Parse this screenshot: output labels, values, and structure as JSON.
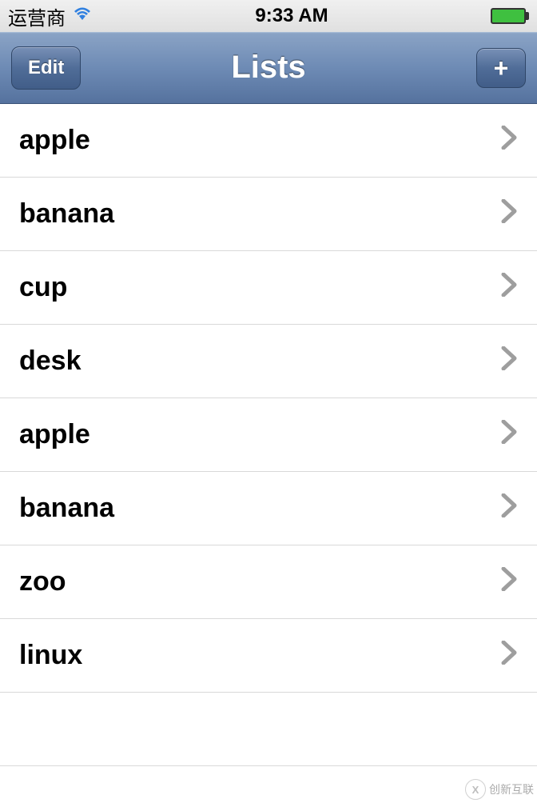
{
  "status_bar": {
    "carrier": "运营商",
    "time": "9:33 AM"
  },
  "nav": {
    "edit_label": "Edit",
    "title": "Lists",
    "add_label": "+"
  },
  "list_items": [
    {
      "label": "apple"
    },
    {
      "label": "banana"
    },
    {
      "label": "cup"
    },
    {
      "label": "desk"
    },
    {
      "label": "apple"
    },
    {
      "label": "banana"
    },
    {
      "label": "zoo"
    },
    {
      "label": "linux"
    }
  ],
  "watermark": {
    "text": "创新互联"
  }
}
